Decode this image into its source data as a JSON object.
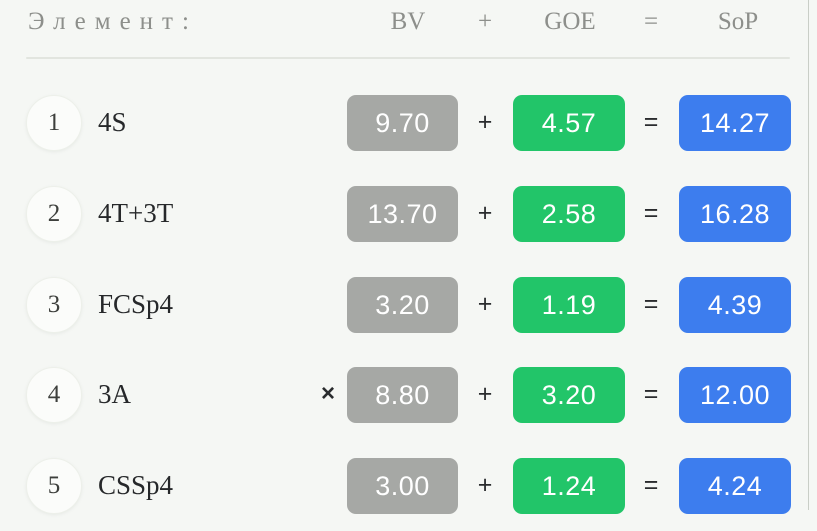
{
  "header": {
    "element_label": "Элемент:",
    "bv_label": "BV",
    "plus_symbol": "+",
    "goe_label": "GOE",
    "equals_symbol": "=",
    "sop_label": "SoP"
  },
  "operators": {
    "plus": "+",
    "equals": "=",
    "multiplier": "×"
  },
  "colors": {
    "background": "#f5f7f4",
    "bv_badge": "#a6a8a5",
    "goe_badge": "#22c569",
    "sop_badge": "#3d7dee",
    "header_text": "#8d8f8b",
    "element_text": "#26282a",
    "divider": "#e2e5df"
  },
  "rows": [
    {
      "number": "1",
      "element": "4S",
      "multiplier": "",
      "bv": "9.70",
      "goe": "4.57",
      "sop": "14.27"
    },
    {
      "number": "2",
      "element": "4T+3T",
      "multiplier": "",
      "bv": "13.70",
      "goe": "2.58",
      "sop": "16.28"
    },
    {
      "number": "3",
      "element": "FCSp4",
      "multiplier": "",
      "bv": "3.20",
      "goe": "1.19",
      "sop": "4.39"
    },
    {
      "number": "4",
      "element": "3A",
      "multiplier": "×",
      "bv": "8.80",
      "goe": "3.20",
      "sop": "12.00"
    },
    {
      "number": "5",
      "element": "CSSp4",
      "multiplier": "",
      "bv": "3.00",
      "goe": "1.24",
      "sop": "4.24"
    }
  ]
}
